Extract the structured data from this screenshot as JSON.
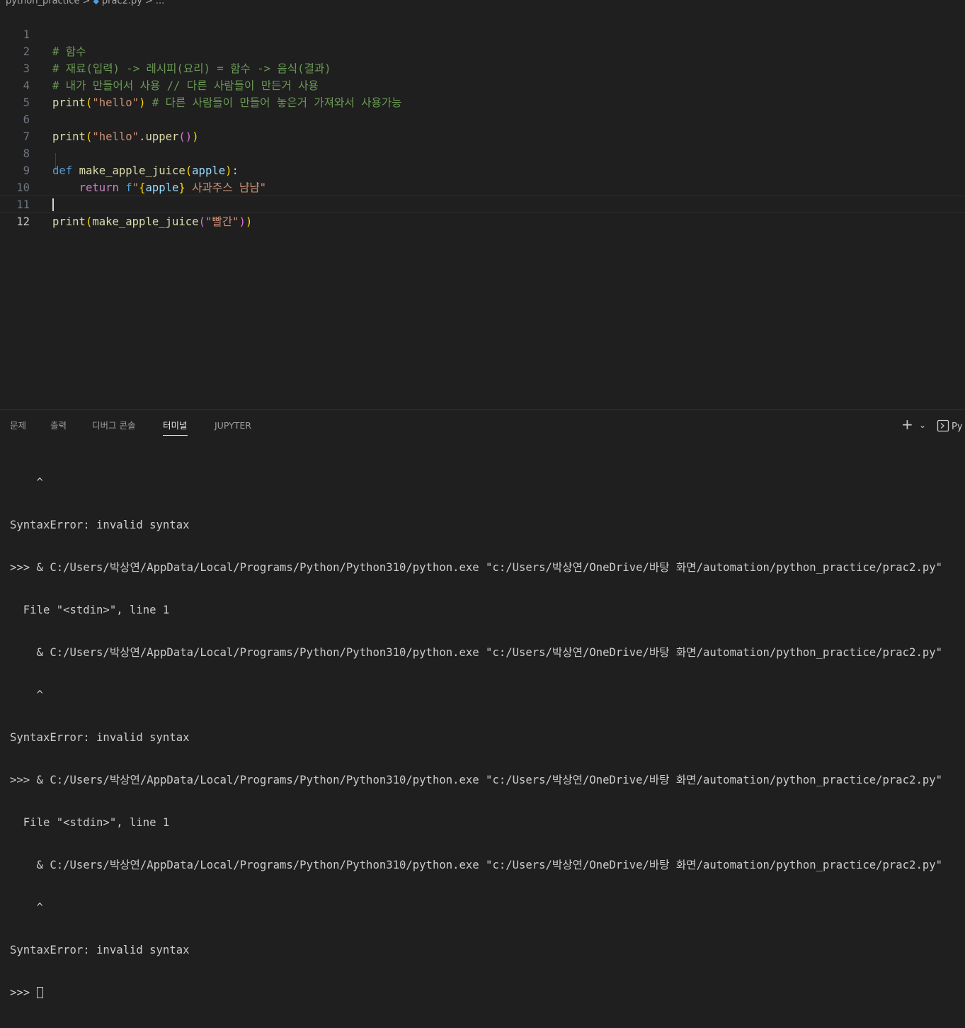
{
  "breadcrumb": {
    "folder": "python_practice",
    "file": "prac2.py",
    "more": "..."
  },
  "editor": {
    "lines": [
      {
        "num": "1",
        "t0": "# 함수"
      },
      {
        "num": "2",
        "t0": "# 재료(입력) -> 레시피(요리) = 함수 -> 음식(결과)"
      },
      {
        "num": "3",
        "t0": "# 내가 만들어서 사용 // 다른 사람들이 만든거 사용"
      },
      {
        "num": "4",
        "t0": "print",
        "t1": "(",
        "t2": "\"hello\"",
        "t3": ")",
        "t4": " # 다른 사람들이 만들어 놓은거 가져와서 사용가능"
      },
      {
        "num": "5"
      },
      {
        "num": "6",
        "t0": "print",
        "t1": "(",
        "t2": "\"hello\"",
        "t3": ".",
        "t4": "upper",
        "t5": "(",
        "t6": ")",
        "t7": ")"
      },
      {
        "num": "7"
      },
      {
        "num": "8",
        "t0": "def",
        "t1": " ",
        "t2": "make_apple_juice",
        "t3": "(",
        "t4": "apple",
        "t5": ")",
        "t6": ":"
      },
      {
        "num": "9",
        "t0": "    ",
        "t1": "return",
        "t2": " ",
        "t3": "f",
        "t4": "\"",
        "t5": "{",
        "t6": "apple",
        "t7": "}",
        "t8": " 사과주스 냠냠\""
      },
      {
        "num": "10"
      },
      {
        "num": "11",
        "t0": "print",
        "t1": "(",
        "t2": "make_apple_juice",
        "t3": "(",
        "t4": "\"빨간\"",
        "t5": ")",
        "t6": ")"
      },
      {
        "num": "12"
      }
    ]
  },
  "panel": {
    "tabs": [
      "문제",
      "출력",
      "디버그 콘솔",
      "터미널",
      "JUPYTER"
    ],
    "active_tab": "터미널",
    "new_terminal": "+",
    "dropdown": "⌄",
    "launch_profile": "Py"
  },
  "terminal": {
    "lines": [
      "    ^",
      "SyntaxError: invalid syntax",
      ">>> & C:/Users/박상연/AppData/Local/Programs/Python/Python310/python.exe \"c:/Users/박상연/OneDrive/바탕 화면/automation/python_practice/prac2.py\"",
      "  File \"<stdin>\", line 1",
      "    & C:/Users/박상연/AppData/Local/Programs/Python/Python310/python.exe \"c:/Users/박상연/OneDrive/바탕 화면/automation/python_practice/prac2.py\"",
      "    ^",
      "SyntaxError: invalid syntax",
      ">>> & C:/Users/박상연/AppData/Local/Programs/Python/Python310/python.exe \"c:/Users/박상연/OneDrive/바탕 화면/automation/python_practice/prac2.py\"",
      "  File \"<stdin>\", line 1",
      "    & C:/Users/박상연/AppData/Local/Programs/Python/Python310/python.exe \"c:/Users/박상연/OneDrive/바탕 화면/automation/python_practice/prac2.py\"",
      "    ^",
      "SyntaxError: invalid syntax"
    ],
    "prompt": ">>> "
  },
  "colors": {
    "background": "#1f1f1f",
    "comment": "#6a9955",
    "function": "#dcdcaa",
    "string": "#ce9178",
    "keyword": "#569cd6",
    "control_keyword": "#c586c0",
    "parameter": "#9cdcfe"
  }
}
